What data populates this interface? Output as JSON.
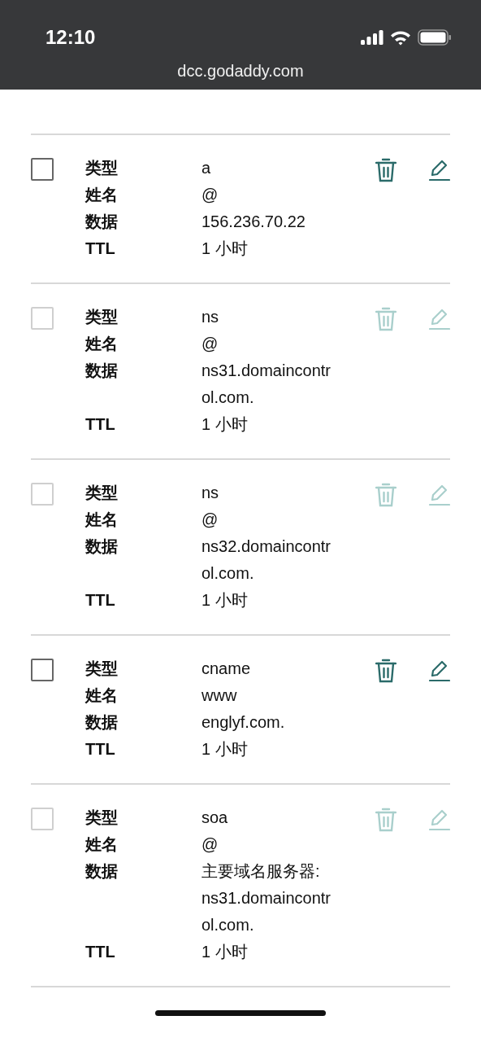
{
  "status_bar": {
    "time": "12:10"
  },
  "address_bar": {
    "url": "dcc.godaddy.com"
  },
  "records": [
    {
      "disabled": false,
      "checked": false,
      "fields": [
        {
          "label": "类型",
          "lines": [
            "a"
          ]
        },
        {
          "label": "姓名",
          "lines": [
            "@"
          ]
        },
        {
          "label": "数据",
          "lines": [
            "156.236.70.22"
          ]
        },
        {
          "label": "TTL",
          "lines": [
            "1 小时"
          ]
        }
      ]
    },
    {
      "disabled": true,
      "checked": false,
      "fields": [
        {
          "label": "类型",
          "lines": [
            "ns"
          ]
        },
        {
          "label": "姓名",
          "lines": [
            "@"
          ]
        },
        {
          "label": "数据",
          "lines": [
            "ns31.domaincontr",
            "ol.com."
          ]
        },
        {
          "label": "TTL",
          "lines": [
            "1 小时"
          ]
        }
      ]
    },
    {
      "disabled": true,
      "checked": false,
      "fields": [
        {
          "label": "类型",
          "lines": [
            "ns"
          ]
        },
        {
          "label": "姓名",
          "lines": [
            "@"
          ]
        },
        {
          "label": "数据",
          "lines": [
            "ns32.domaincontr",
            "ol.com."
          ]
        },
        {
          "label": "TTL",
          "lines": [
            "1 小时"
          ]
        }
      ]
    },
    {
      "disabled": false,
      "checked": false,
      "fields": [
        {
          "label": "类型",
          "lines": [
            "cname"
          ]
        },
        {
          "label": "姓名",
          "lines": [
            "www"
          ]
        },
        {
          "label": "数据",
          "lines": [
            "englyf.com."
          ]
        },
        {
          "label": "TTL",
          "lines": [
            "1 小时"
          ]
        }
      ]
    },
    {
      "disabled": true,
      "checked": false,
      "fields": [
        {
          "label": "类型",
          "lines": [
            "soa"
          ]
        },
        {
          "label": "姓名",
          "lines": [
            "@"
          ]
        },
        {
          "label": "数据",
          "lines": [
            "主要域名服务器:",
            "ns31.domaincontr",
            "ol.com."
          ]
        },
        {
          "label": "TTL",
          "lines": [
            "1 小时"
          ]
        }
      ]
    }
  ]
}
